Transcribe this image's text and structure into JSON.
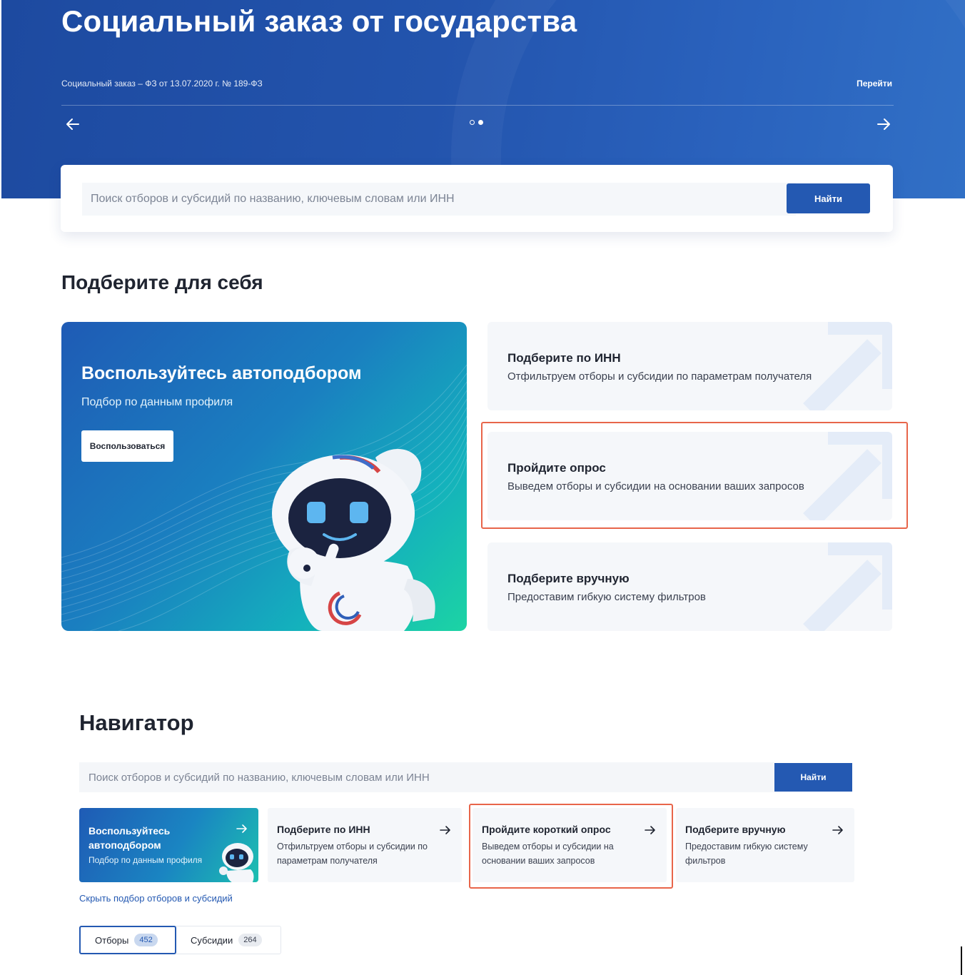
{
  "hero": {
    "title": "Социальный заказ от государства",
    "subtitle": "Социальный заказ – ФЗ от 13.07.2020 г. № 189-ФЗ",
    "link": "Перейти",
    "slides_total": 2,
    "slide_active": 2
  },
  "search": {
    "placeholder": "Поиск отборов и субсидий по названию, ключевым словам или ИНН",
    "button": "Найти"
  },
  "pick": {
    "title": "Подберите для себя",
    "auto": {
      "title": "Воспользуйтесь автоподбором",
      "subtitle": "Подбор по данным профиля",
      "button": "Воспользоваться"
    },
    "options": [
      {
        "title": "Подберите по ИНН",
        "desc": "Отфильтруем отборы и субсидии по параметрам получателя"
      },
      {
        "title": "Пройдите опрос",
        "desc": "Выведем отборы и субсидии на основании ваших запросов"
      },
      {
        "title": "Подберите вручную",
        "desc": "Предоставим гибкую систему фильтров"
      }
    ]
  },
  "navigator": {
    "title": "Навигатор",
    "search_placeholder": "Поиск отборов и субсидий по названию, ключевым словам или ИНН",
    "search_button": "Найти",
    "auto": {
      "title": "Воспользуйтесь автоподбором",
      "desc": "Подбор по данным профиля"
    },
    "cards": [
      {
        "title": "Подберите по ИНН",
        "desc": "Отфильтруем отборы и субсидии по параметрам получателя"
      },
      {
        "title": "Пройдите короткий опрос",
        "desc": "Выведем отборы и субсидии на основании ваших запросов"
      },
      {
        "title": "Подберите вручную",
        "desc": "Предоставим гибкую систему фильтров"
      }
    ],
    "hide_link": "Скрыть подбор отборов и субсидий",
    "tabs": [
      {
        "label": "Отборы",
        "count": "452",
        "active": true
      },
      {
        "label": "Субсидии",
        "count": "264",
        "active": false
      }
    ]
  },
  "colors": {
    "brand": "#2459b2",
    "highlight": "#e8654a",
    "card_bg": "#f5f7fa"
  },
  "icons": [
    "arrow-left-icon",
    "arrow-right-icon",
    "diagonal-arrow-icon",
    "robot-mascot"
  ]
}
